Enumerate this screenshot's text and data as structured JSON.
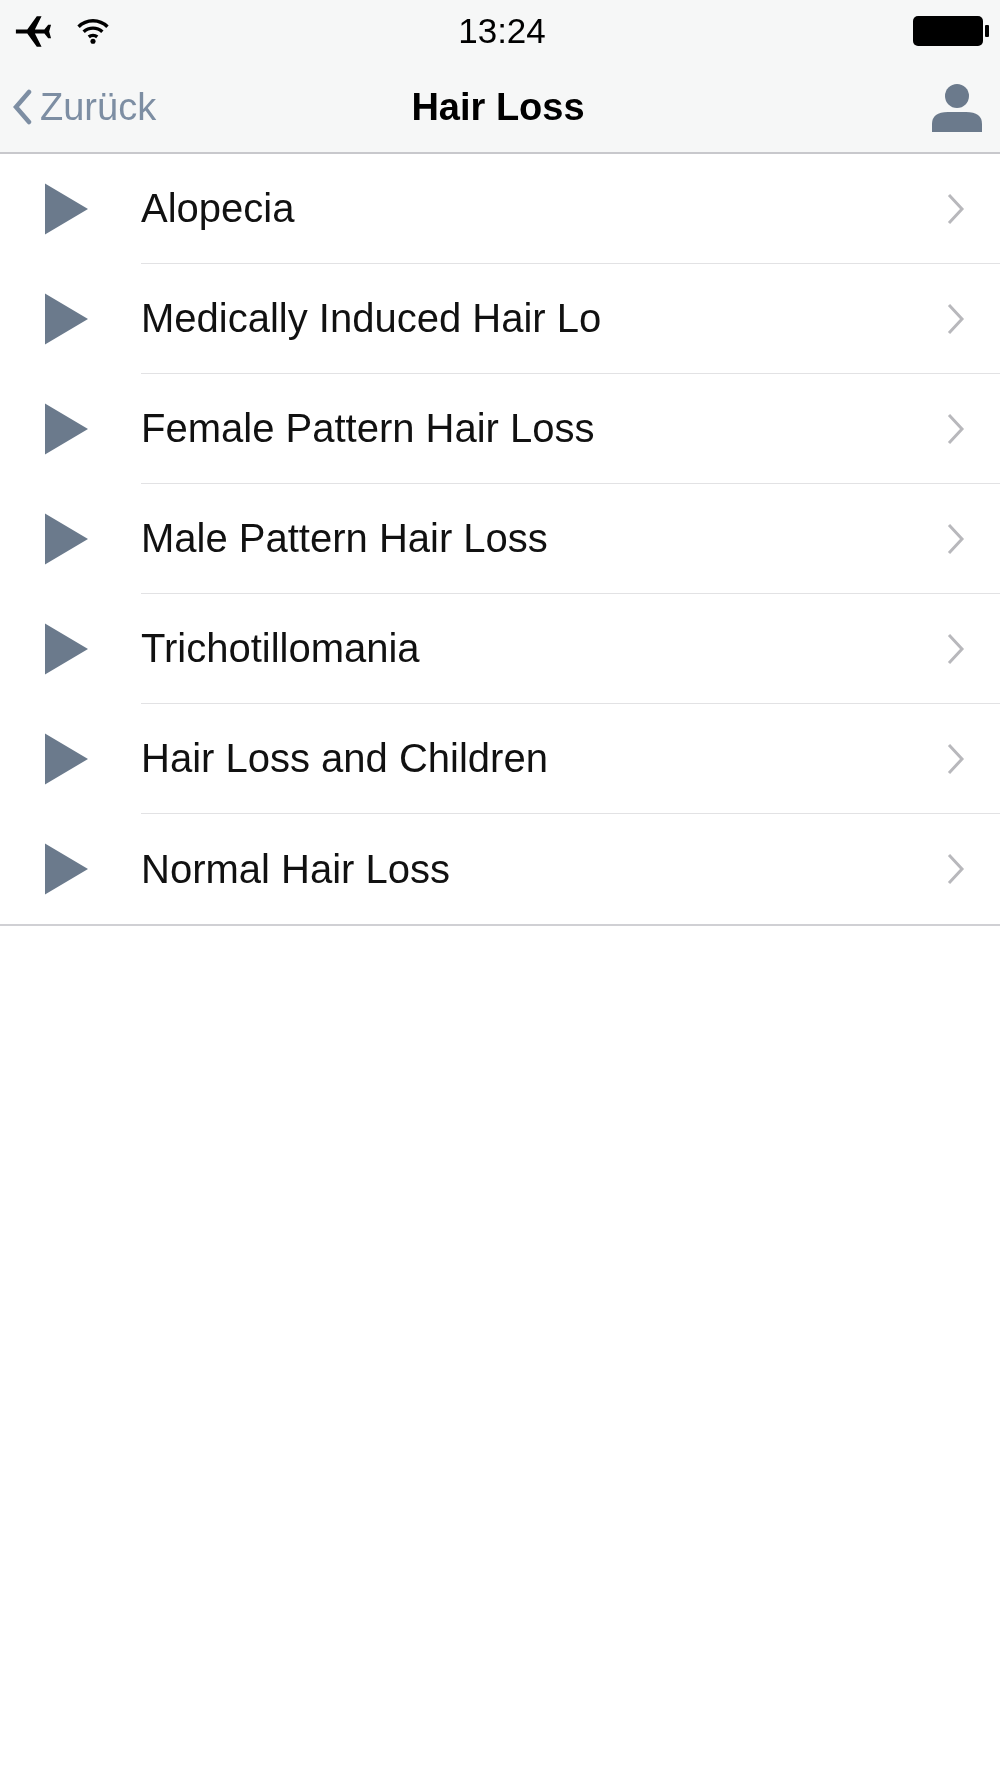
{
  "status_bar": {
    "time": "13:24"
  },
  "nav_bar": {
    "back": "Zurück",
    "title": "Hair Loss"
  },
  "items": [
    {
      "label": "Alopecia"
    },
    {
      "label": "Medically Induced Hair Lo"
    },
    {
      "label": "Female Pattern Hair Loss"
    },
    {
      "label": "Male Pattern Hair Loss"
    },
    {
      "label": "Trichotillomania"
    },
    {
      "label": "Hair Loss and Children"
    },
    {
      "label": "Normal Hair Loss"
    }
  ]
}
